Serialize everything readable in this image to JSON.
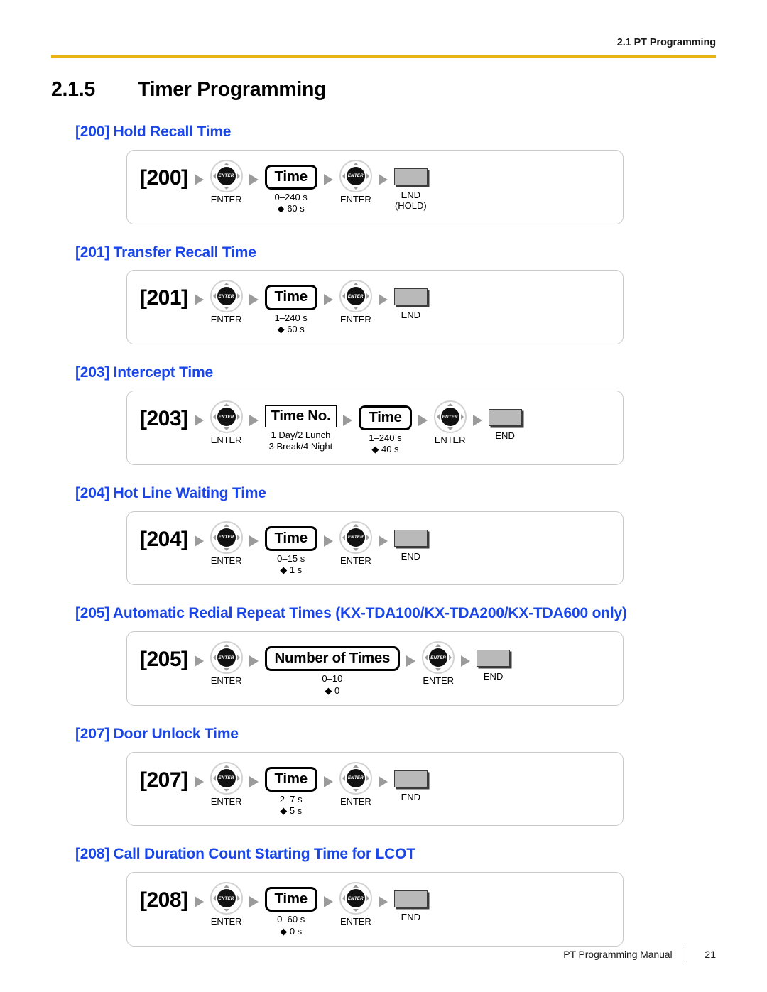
{
  "header": {
    "running_head": "2.1 PT Programming",
    "rule_color": "#e8b413"
  },
  "chapter": {
    "number": "2.1.5",
    "title": "Timer Programming"
  },
  "accent_color": "#1a46e8",
  "labels": {
    "enter": "ENTER",
    "end": "END",
    "end_hold": "(HOLD)"
  },
  "sections": [
    {
      "heading": "[200] Hold Recall Time",
      "code": "[200]",
      "steps": [
        {
          "label": "Time",
          "range": "0–240 s",
          "default": "◆ 60 s",
          "style": "thick"
        }
      ],
      "end_sub": "(HOLD)"
    },
    {
      "heading": "[201] Transfer Recall Time",
      "code": "[201]",
      "steps": [
        {
          "label": "Time",
          "range": "1–240 s",
          "default": "◆ 60 s",
          "style": "thick"
        }
      ],
      "end_sub": ""
    },
    {
      "heading": "[203] Intercept Time",
      "code": "[203]",
      "steps": [
        {
          "label": "Time No.",
          "range": "1 Day/2 Lunch",
          "default": "3 Break/4 Night",
          "style": "thin"
        },
        {
          "label": "Time",
          "range": "1–240 s",
          "default": "◆ 40 s",
          "style": "thick"
        }
      ],
      "end_sub": ""
    },
    {
      "heading": "[204] Hot Line Waiting Time",
      "code": "[204]",
      "steps": [
        {
          "label": "Time",
          "range": "0–15 s",
          "default": "◆ 1 s",
          "style": "thick"
        }
      ],
      "end_sub": ""
    },
    {
      "heading": "[205] Automatic Redial Repeat Times (KX-TDA100/KX-TDA200/KX-TDA600 only)",
      "code": "[205]",
      "steps": [
        {
          "label": "Number of Times",
          "range": "0–10",
          "default": "◆ 0",
          "style": "thick"
        }
      ],
      "end_sub": ""
    },
    {
      "heading": "[207] Door Unlock Time",
      "code": "[207]",
      "steps": [
        {
          "label": "Time",
          "range": "2–7 s",
          "default": "◆ 5 s",
          "style": "thick"
        }
      ],
      "end_sub": ""
    },
    {
      "heading": "[208] Call Duration Count Starting Time for LCOT",
      "code": "[208]",
      "steps": [
        {
          "label": "Time",
          "range": "0–60 s",
          "default": "◆ 0 s",
          "style": "thick"
        }
      ],
      "end_sub": ""
    }
  ],
  "footer": {
    "manual": "PT Programming Manual",
    "page_number": "21"
  }
}
